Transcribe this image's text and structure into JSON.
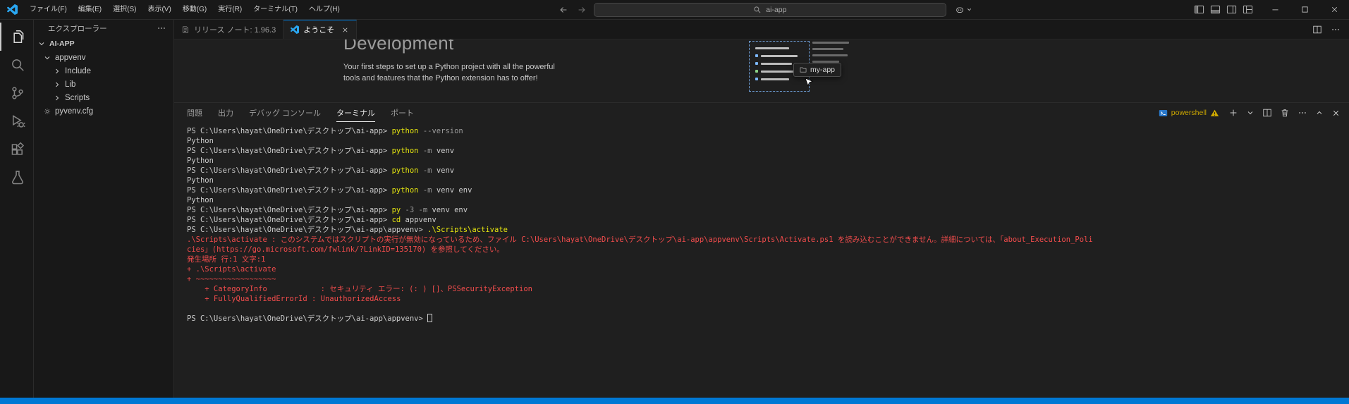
{
  "colors": {
    "accent": "#0078d4",
    "statusbar": "#0078d4",
    "terminal-command": "#e5e510",
    "terminal-error": "#f14c4c",
    "warning": "#cca700"
  },
  "titlebar": {
    "menus": [
      "ファイル(F)",
      "編集(E)",
      "選択(S)",
      "表示(V)",
      "移動(G)",
      "実行(R)",
      "ターミナル(T)",
      "ヘルプ(H)"
    ],
    "search_value": "ai-app",
    "layout_icons": [
      "toggle-primary-sidebar",
      "toggle-panel",
      "toggle-secondary-sidebar",
      "customize-layout"
    ],
    "window_controls": [
      "minimize",
      "maximize",
      "close"
    ]
  },
  "activity_bar": {
    "items": [
      {
        "name": "explorer",
        "active": true
      },
      {
        "name": "search",
        "active": false
      },
      {
        "name": "source-control",
        "active": false
      },
      {
        "name": "run-and-debug",
        "active": false
      },
      {
        "name": "extensions",
        "active": false
      },
      {
        "name": "testing",
        "active": false
      }
    ]
  },
  "sidebar": {
    "title": "エクスプローラー",
    "section": "AI-APP",
    "tree": [
      {
        "label": "appvenv",
        "chevron": "down"
      },
      {
        "label": "Include",
        "chevron": "right"
      },
      {
        "label": "Lib",
        "chevron": "right"
      },
      {
        "label": "Scripts",
        "chevron": "right"
      },
      {
        "label": "pyvenv.cfg",
        "icon": "gear"
      }
    ]
  },
  "tabs": [
    {
      "label": "リリース ノート: 1.96.3",
      "icon": "release-notes",
      "active": false
    },
    {
      "label": "ようこそ",
      "icon": "vscode-logo",
      "active": true,
      "closable": true
    }
  ],
  "welcome": {
    "heading": "Development",
    "paragraph_line1": "Your first steps to set up a Python project with all the powerful",
    "paragraph_line2": "tools and features that the Python extension has to offer!",
    "tooltip": "my-app"
  },
  "panel": {
    "tabs": [
      {
        "label": "問題",
        "active": false
      },
      {
        "label": "出力",
        "active": false
      },
      {
        "label": "デバッグ コンソール",
        "active": false
      },
      {
        "label": "ターミナル",
        "active": true
      },
      {
        "label": "ポート",
        "active": false
      }
    ],
    "shell_label": "powershell",
    "shell_warning": true,
    "actions": [
      "new-terminal",
      "launch-profile-chevron",
      "split-terminal",
      "kill-terminal",
      "more-actions",
      "maximize-panel",
      "close-panel"
    ]
  },
  "terminal": {
    "lines": [
      [
        {
          "t": "PS C:\\Users\\hayat\\OneDrive\\デスクトップ\\ai-app> ",
          "c": "p"
        },
        {
          "t": "python ",
          "c": "c"
        },
        {
          "t": "--version",
          "c": "f"
        }
      ],
      [
        {
          "t": "Python",
          "c": "o"
        }
      ],
      [
        {
          "t": "PS C:\\Users\\hayat\\OneDrive\\デスクトップ\\ai-app> ",
          "c": "p"
        },
        {
          "t": "python ",
          "c": "c"
        },
        {
          "t": "-m ",
          "c": "f"
        },
        {
          "t": "venv",
          "c": "a"
        }
      ],
      [
        {
          "t": "Python",
          "c": "o"
        }
      ],
      [
        {
          "t": "PS C:\\Users\\hayat\\OneDrive\\デスクトップ\\ai-app> ",
          "c": "p"
        },
        {
          "t": "python ",
          "c": "c"
        },
        {
          "t": "-m ",
          "c": "f"
        },
        {
          "t": "venv",
          "c": "a"
        }
      ],
      [
        {
          "t": "Python",
          "c": "o"
        }
      ],
      [
        {
          "t": "PS C:\\Users\\hayat\\OneDrive\\デスクトップ\\ai-app> ",
          "c": "p"
        },
        {
          "t": "python ",
          "c": "c"
        },
        {
          "t": "-m ",
          "c": "f"
        },
        {
          "t": "venv env",
          "c": "a"
        }
      ],
      [
        {
          "t": "Python",
          "c": "o"
        }
      ],
      [
        {
          "t": "PS C:\\Users\\hayat\\OneDrive\\デスクトップ\\ai-app> ",
          "c": "p"
        },
        {
          "t": "py ",
          "c": "c"
        },
        {
          "t": "-3 -m ",
          "c": "f"
        },
        {
          "t": "venv env",
          "c": "a"
        }
      ],
      [
        {
          "t": "PS C:\\Users\\hayat\\OneDrive\\デスクトップ\\ai-app> ",
          "c": "p"
        },
        {
          "t": "cd ",
          "c": "c"
        },
        {
          "t": "appvenv",
          "c": "a"
        }
      ],
      [
        {
          "t": "PS C:\\Users\\hayat\\OneDrive\\デスクトップ\\ai-app\\appvenv> ",
          "c": "p"
        },
        {
          "t": ".\\Scripts\\activate",
          "c": "c"
        }
      ],
      [
        {
          "t": ".\\Scripts\\activate : このシステムではスクリプトの実行が無効になっているため、ファイル C:\\Users\\hayat\\OneDrive\\デスクトップ\\ai-app\\appvenv\\Scripts\\Activate.ps1 を読み込むことができません。詳細については、「about_Execution_Poli",
          "c": "e"
        }
      ],
      [
        {
          "t": "cies」(https://go.microsoft.com/fwlink/?LinkID=135170) を参照してください。",
          "c": "e"
        }
      ],
      [
        {
          "t": "発生場所 行:1 文字:1",
          "c": "e"
        }
      ],
      [
        {
          "t": "+ .\\Scripts\\activate",
          "c": "e"
        }
      ],
      [
        {
          "t": "+ ~~~~~~~~~~~~~~~~~~",
          "c": "e"
        }
      ],
      [
        {
          "t": "    + CategoryInfo            : セキュリティ エラー: (: ) []、PSSecurityException",
          "c": "e"
        }
      ],
      [
        {
          "t": "    + FullyQualifiedErrorId : UnauthorizedAccess",
          "c": "e"
        }
      ],
      [],
      [
        {
          "t": "PS C:\\Users\\hayat\\OneDrive\\デスクトップ\\ai-app\\appvenv> ",
          "c": "p"
        },
        {
          "t": "",
          "c": "cur"
        }
      ]
    ]
  }
}
